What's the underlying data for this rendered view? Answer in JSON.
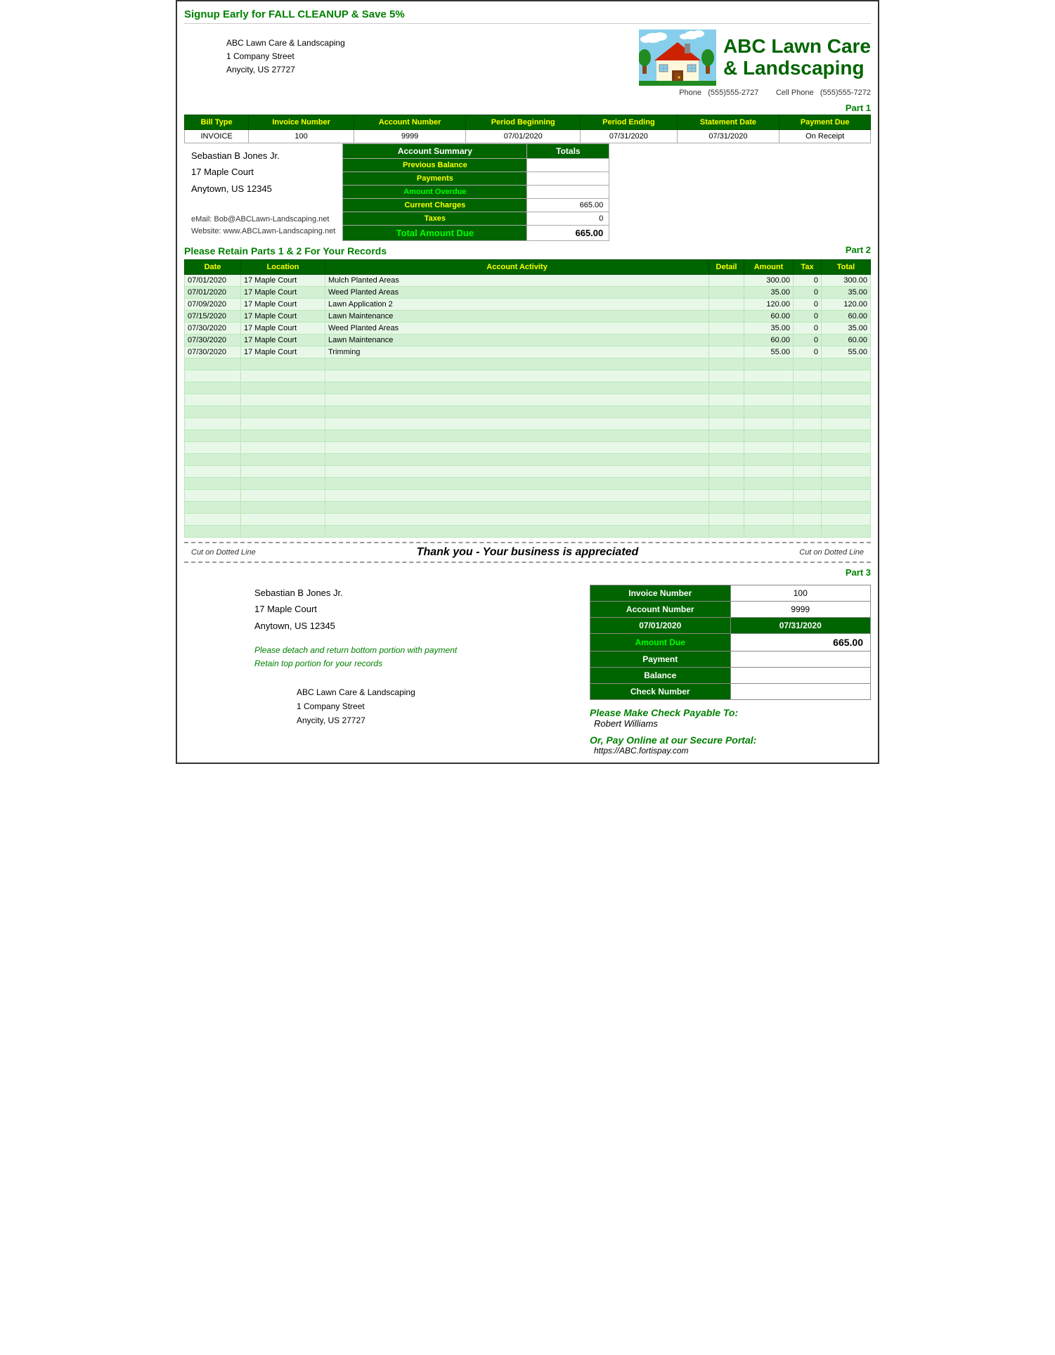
{
  "banner": {
    "text": "Signup Early for FALL CLEANUP & Save 5%"
  },
  "company": {
    "name": "ABC Lawn Care & Landscaping",
    "address1": "1 Company Street",
    "address2": "Anycity, US  27727",
    "logo_name": "ABC Lawn Care",
    "logo_sub": "& Landscaping",
    "phone_label": "Phone",
    "phone": "(555)555-2727",
    "cell_label": "Cell Phone",
    "cell": "(555)555-7272"
  },
  "part1": {
    "label": "Part 1",
    "table": {
      "headers": [
        "Bill Type",
        "Invoice Number",
        "Account Number",
        "Period Beginning",
        "Period Ending",
        "Statement Date",
        "Payment Due"
      ],
      "row": {
        "bill_type": "INVOICE",
        "invoice_number": "100",
        "account_number": "9999",
        "period_beginning": "07/01/2020",
        "period_ending": "07/31/2020",
        "statement_date": "07/31/2020",
        "payment_due": "On Receipt"
      }
    }
  },
  "customer": {
    "name": "Sebastian B Jones Jr.",
    "address1": "17 Maple Court",
    "address2": "Anytown, US  12345",
    "email_label": "eMail:",
    "email": "Bob@ABCLawn-Landscaping.net",
    "website_label": "Website:",
    "website": "www.ABCLawn-Landscaping.net"
  },
  "account_summary": {
    "header_label": "Account Summary",
    "header_totals": "Totals",
    "previous_balance": "Previous Balance",
    "previous_balance_value": "",
    "payments": "Payments",
    "payments_value": "",
    "amount_overdue": "Amount Overdue",
    "amount_overdue_value": "",
    "current_charges": "Current Charges",
    "current_charges_value": "665.00",
    "taxes": "Taxes",
    "taxes_value": "0",
    "total_label": "Total Amount Due",
    "total_value": "665.00"
  },
  "retain_message": "Please Retain Parts 1 & 2 For Your Records",
  "part2": {
    "label": "Part 2",
    "table": {
      "headers": [
        "Date",
        "Location",
        "Account Activity",
        "Detail",
        "Amount",
        "Tax",
        "Total"
      ],
      "rows": [
        {
          "date": "07/01/2020",
          "location": "17 Maple Court",
          "activity": "Mulch Planted Areas",
          "detail": "",
          "amount": "300.00",
          "tax": "0",
          "total": "300.00"
        },
        {
          "date": "07/01/2020",
          "location": "17 Maple Court",
          "activity": "Weed Planted Areas",
          "detail": "",
          "amount": "35.00",
          "tax": "0",
          "total": "35.00"
        },
        {
          "date": "07/09/2020",
          "location": "17 Maple Court",
          "activity": "Lawn Application 2",
          "detail": "",
          "amount": "120.00",
          "tax": "0",
          "total": "120.00"
        },
        {
          "date": "07/15/2020",
          "location": "17 Maple Court",
          "activity": "Lawn Maintenance",
          "detail": "",
          "amount": "60.00",
          "tax": "0",
          "total": "60.00"
        },
        {
          "date": "07/30/2020",
          "location": "17 Maple Court",
          "activity": "Weed Planted Areas",
          "detail": "",
          "amount": "35.00",
          "tax": "0",
          "total": "35.00"
        },
        {
          "date": "07/30/2020",
          "location": "17 Maple Court",
          "activity": "Lawn Maintenance",
          "detail": "",
          "amount": "60.00",
          "tax": "0",
          "total": "60.00"
        },
        {
          "date": "07/30/2020",
          "location": "17 Maple Court",
          "activity": "Trimming",
          "detail": "",
          "amount": "55.00",
          "tax": "0",
          "total": "55.00"
        }
      ]
    }
  },
  "cut_line": {
    "left": "Cut on Dotted Line",
    "right": "Cut on Dotted Line",
    "thank_you": "Thank you - Your business is appreciated"
  },
  "part3": {
    "label": "Part 3",
    "customer": {
      "name": "Sebastian B Jones Jr.",
      "address1": "17 Maple Court",
      "address2": "Anytown, US  12345"
    },
    "detach_note": "Please detach and return bottom portion with payment\nRetain top portion for your records",
    "return_address": {
      "name": "ABC Lawn Care & Landscaping",
      "address1": "1 Company Street",
      "address2": "Anycity, US   27727"
    },
    "table": {
      "invoice_label": "Invoice Number",
      "invoice_value": "100",
      "account_label": "Account Number",
      "account_value": "9999",
      "period_begin": "07/01/2020",
      "period_end": "07/31/2020",
      "amount_due_label": "Amount Due",
      "amount_due_value": "665.00",
      "payment_label": "Payment",
      "payment_value": "",
      "balance_label": "Balance",
      "balance_value": "",
      "check_label": "Check Number",
      "check_value": ""
    },
    "pay_check_label": "Please Make Check Payable To:",
    "payee": "Robert Williams",
    "pay_online_label": "Or, Pay Online at our Secure Portal:",
    "portal_url": "https://ABC.fortispay.com"
  }
}
